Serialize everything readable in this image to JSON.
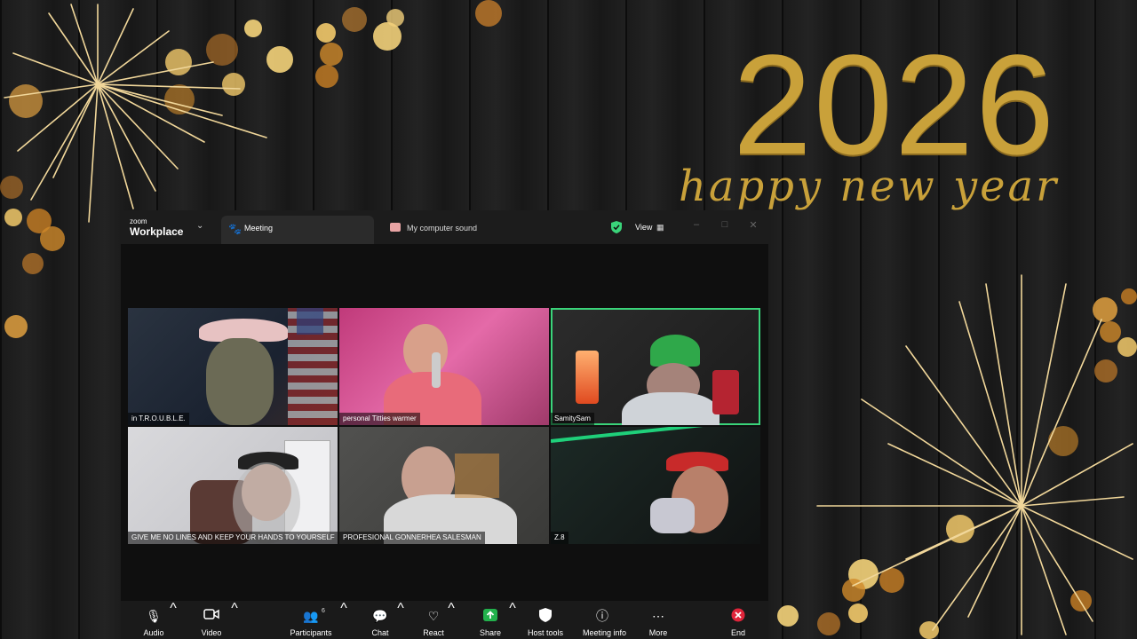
{
  "background": {
    "year": "2026",
    "greeting": "happy new year"
  },
  "window": {
    "brand_small": "zoom",
    "brand_big": "Workplace",
    "tabs": [
      {
        "label": "Meeting"
      },
      {
        "label": "My computer sound"
      }
    ],
    "view_label": "View"
  },
  "participants": [
    {
      "name": "in T.R.O.U.B.L.E."
    },
    {
      "name": "personal Titties warmer"
    },
    {
      "name": "SamitySam",
      "active": true
    },
    {
      "name": "GIVE ME NO LINES AND KEEP YOUR HANDS TO YOURSELF"
    },
    {
      "name": "PROFESIONAL GONNERHEA SALESMAN"
    },
    {
      "name": "Z.8"
    }
  ],
  "toolbar": {
    "audio": "Audio",
    "video": "Video",
    "participants": "Participants",
    "participants_count": "6",
    "chat": "Chat",
    "react": "React",
    "share": "Share",
    "host_tools": "Host tools",
    "meeting_info": "Meeting info",
    "more": "More",
    "end": "End"
  },
  "colors": {
    "gold": "#c9a13a",
    "active_outline": "#3ad47a",
    "share_green": "#22b14c",
    "end_red": "#e0243a"
  }
}
